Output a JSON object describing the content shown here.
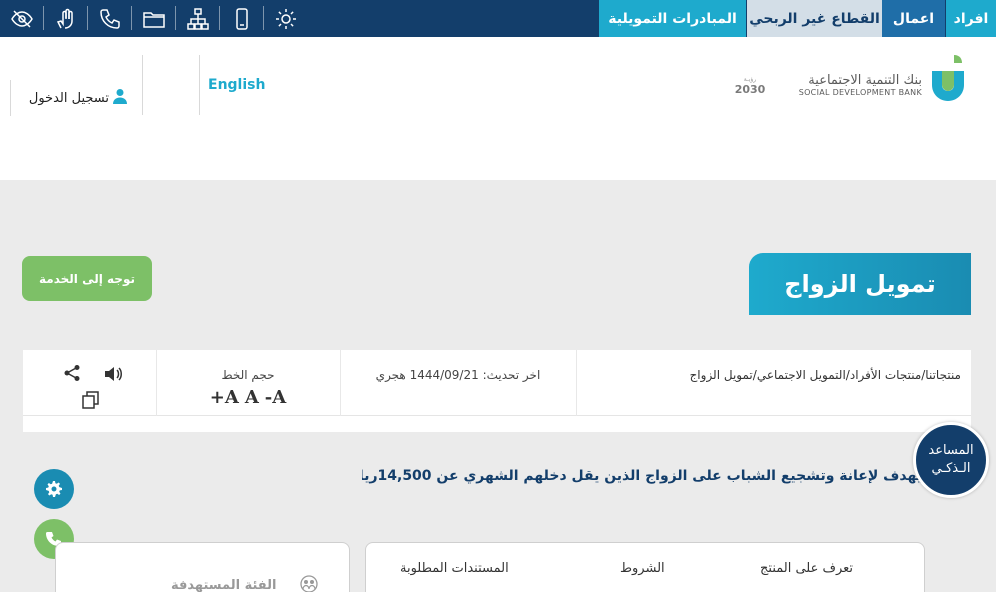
{
  "topbar": {
    "tabs": {
      "individuals": "افراد",
      "business": "اعمال",
      "nonprofit": "القطاع غير الربحي",
      "initiatives": "المبادرات التمويلية"
    },
    "icons": [
      "eye-slash-icon",
      "sign-language-icon",
      "phone-icon",
      "folder-icon",
      "sitemap-icon",
      "mobile-icon",
      "gear-ornament-icon"
    ]
  },
  "header": {
    "login_label": "تسجيل الدخول",
    "language_label": "English",
    "bank_name_ar": "بنك التنمية الاجتماعية",
    "bank_name_en": "SOCIAL DEVELOPMENT BANK",
    "vision_label": "2030"
  },
  "hero": {
    "title": "تمويل الزواج",
    "goto_button": "توجه إلى الخدمة"
  },
  "info": {
    "breadcrumb": [
      "منتجاتنا",
      "منتجات الأفراد",
      "التمويل الاجتماعي",
      "تمويل الزواج"
    ],
    "last_update": "اخر تحديث: 1444/09/21 هجري",
    "font_size_label": "حجم الخط",
    "font_controls": [
      "+A",
      "A",
      "-A"
    ]
  },
  "description": "يهدف لإعانة وتشجيع الشباب على الزواج الذين يقل دخلهم الشهري عن 14,500ريال.",
  "assistant": {
    "line1": "المساعد",
    "line2": "الـذكـي"
  },
  "product_tabs": {
    "about": "تعرف على المنتج",
    "conditions": "الشروط",
    "documents": "المستندات المطلوبة"
  },
  "target": {
    "label": "الفئة المستهدفة"
  },
  "colors": {
    "navy": "#133e6b",
    "teal": "#1eaacd",
    "green": "#7dc067"
  }
}
